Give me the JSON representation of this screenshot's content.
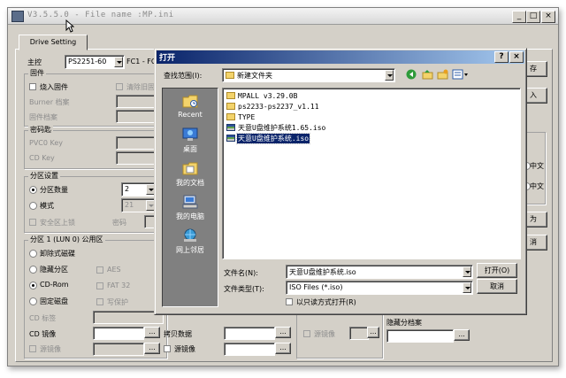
{
  "main_window": {
    "title": "V3.5.5.0 - File name :MP.ini",
    "minimize_label": "_",
    "maximize_label": "□",
    "close_label": "×",
    "tab_label": "Drive Setting",
    "controller_label": "主控",
    "controller_value": "PS2251-60",
    "fc1_label": "FC1 - FC",
    "firmware_group": "固件",
    "burn_firmware_label": "烧入固件",
    "clear_old_label": "清除旧固",
    "burner_file_label": "Burner 档案",
    "firmware_file_label": "固件档案",
    "password_group": "密码匙",
    "pvc0_key_label": "PVC0 Key",
    "cd_key_label": "CD Key",
    "partition_group": "分区设置",
    "partition_count_label": "分区数量",
    "partition_count_value": "2",
    "mode_label": "模式",
    "mode_value": "21",
    "secure_lock_label": "安全区上锁",
    "password_label": "密码",
    "partition1_group": "分区 1 (LUN 0) 公用区",
    "removable_disk_label": "卸除式磁碟",
    "hidden_partition_label": "隐藏分区",
    "aes_label": "AES",
    "cdrom_label": "CD-Rom",
    "fat32_label": "FAT 32",
    "fixed_disk_label": "固定磁盘",
    "write_protect_label": "写保护",
    "cd_label_label": "CD 标签",
    "cd_image_label": "CD 镜像",
    "source_image_label": "源镜像",
    "copy_data_label": "拷贝数据",
    "source_image2_label": "源镜像",
    "source_image3_label": "源镜像",
    "hidden_partition_file_label": "隐藏分档案",
    "browse_label": "...",
    "right_btn_1": "存",
    "right_btn_2": "入",
    "right_label_1": "中文",
    "right_label_2": "中文",
    "right_btn_3": "为",
    "right_btn_4": "消"
  },
  "dialog": {
    "title": "打开",
    "help_label": "?",
    "close_label": "×",
    "lookin_label": "查找范围(I):",
    "lookin_value": "新建文件夹",
    "places": [
      {
        "label": "Recent",
        "icon": "recent-icon"
      },
      {
        "label": "桌面",
        "icon": "desktop-icon"
      },
      {
        "label": "我的文档",
        "icon": "my-documents-icon"
      },
      {
        "label": "我的电脑",
        "icon": "my-computer-icon"
      },
      {
        "label": "网上邻居",
        "icon": "network-places-icon"
      }
    ],
    "files": [
      {
        "name": "MPALL v3.29.0B",
        "type": "folder"
      },
      {
        "name": "ps2233-ps2237_v1.11",
        "type": "folder"
      },
      {
        "name": "TYPE",
        "type": "folder"
      },
      {
        "name": "天意U盘维护系统1.65.iso",
        "type": "iso"
      },
      {
        "name": "天意U盘维护系统.iso",
        "type": "iso"
      }
    ],
    "filename_label": "文件名(N):",
    "filename_value": "天意U盘维护系统.iso",
    "filetype_label": "文件类型(T):",
    "filetype_value": "ISO Files (*.iso)",
    "readonly_label": "以只读方式打开(R)",
    "open_button": "打开(O)",
    "cancel_button": "取消"
  }
}
